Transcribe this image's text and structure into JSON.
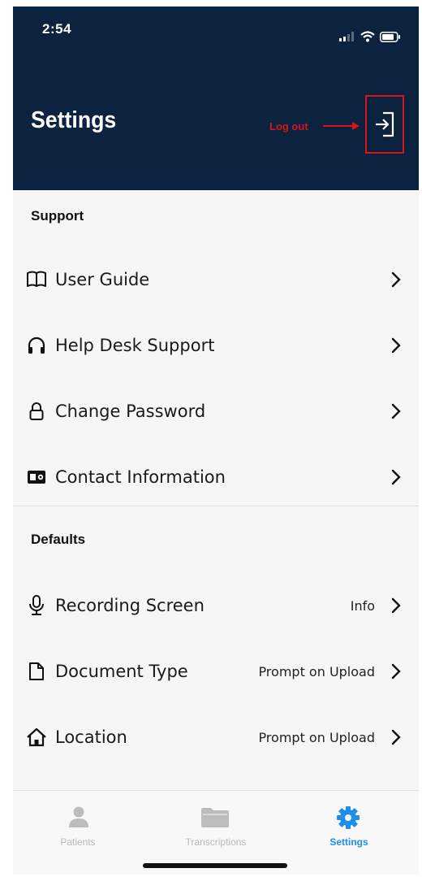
{
  "status_bar": {
    "time": "2:54"
  },
  "header": {
    "title": "Settings",
    "annotation": "Log out"
  },
  "sections": {
    "support": {
      "title": "Support",
      "items": [
        {
          "label": "User Guide",
          "icon": "book-icon"
        },
        {
          "label": "Help Desk Support",
          "icon": "headphones-icon"
        },
        {
          "label": "Change Password",
          "icon": "lock-icon"
        },
        {
          "label": "Contact Information",
          "icon": "contact-card-icon"
        }
      ]
    },
    "defaults": {
      "title": "Defaults",
      "items": [
        {
          "label": "Recording Screen",
          "value": "Info",
          "icon": "microphone-icon"
        },
        {
          "label": "Document Type",
          "value": "Prompt on Upload",
          "icon": "document-icon"
        },
        {
          "label": "Location",
          "value": "Prompt on Upload",
          "icon": "home-icon"
        }
      ]
    }
  },
  "tabs": [
    {
      "label": "Patients",
      "icon": "person-icon",
      "active": false
    },
    {
      "label": "Transcriptions",
      "icon": "folder-icon",
      "active": false
    },
    {
      "label": "Settings",
      "icon": "gear-icon",
      "active": true
    }
  ],
  "colors": {
    "header_bg": "#0c2340",
    "accent": "#1e8ee8",
    "annotation": "#d8141c"
  }
}
